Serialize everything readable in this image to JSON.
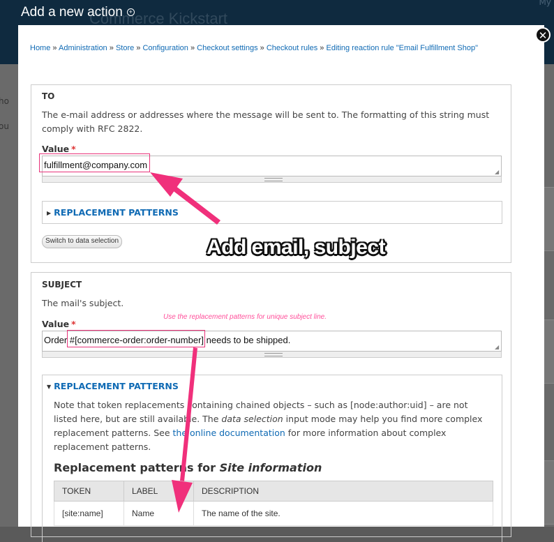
{
  "background": {
    "brand_text": "Commerce Kickstart",
    "top_right_text": "My",
    "left_fragments": [
      "ho",
      "ou"
    ]
  },
  "dialog": {
    "title": "Add a new action",
    "close_symbol": "✕",
    "title_icon": "plus-circle-icon"
  },
  "breadcrumb": {
    "items": [
      "Home",
      "Administration",
      "Store",
      "Configuration",
      "Checkout settings",
      "Checkout rules",
      "Editing reaction rule \"Email Fulfillment Shop\""
    ],
    "separator": "»"
  },
  "to_section": {
    "legend": "TO",
    "description": "The e-mail address or addresses where the message will be sent to. The formatting of this string must comply with RFC 2822.",
    "value_label": "Value",
    "required_marker": "*",
    "value": "fulfillment@company.com",
    "replacement_patterns_label": "REPLACEMENT PATTERNS",
    "switch_button": "Switch to data selection"
  },
  "subject_section": {
    "legend": "SUBJECT",
    "description": "The mail's subject.",
    "value_label": "Value",
    "required_marker": "*",
    "value_prefix": "Order ",
    "value_token": "#[commerce-order:order-number]",
    "value_suffix": " needs to be shipped.",
    "replacement_patterns_label": "REPLACEMENT PATTERNS",
    "note_part1": "Note that token replacements containing chained objects – such as [node:author:uid] – are not listed here, but are still available. The ",
    "note_italic": "data selection",
    "note_part2": " input mode may help you find more complex replacement patterns. See ",
    "note_link": "the online documentation",
    "note_part3": " for more information about complex replacement patterns.",
    "rp_heading_prefix": "Replacement patterns for ",
    "rp_heading_italic": "Site information",
    "table": {
      "headers": [
        "TOKEN",
        "LABEL",
        "DESCRIPTION"
      ],
      "rows": [
        [
          "[site:name]",
          "Name",
          "The name of the site."
        ]
      ]
    }
  },
  "annotations": {
    "main": "Add email, subject",
    "small": "Use the replacement patterns for unique subject line.",
    "color": "#e8337a"
  },
  "colors": {
    "link": "#0f6ab4",
    "header_bg": "#0f2a3f",
    "required": "#dd3333"
  }
}
